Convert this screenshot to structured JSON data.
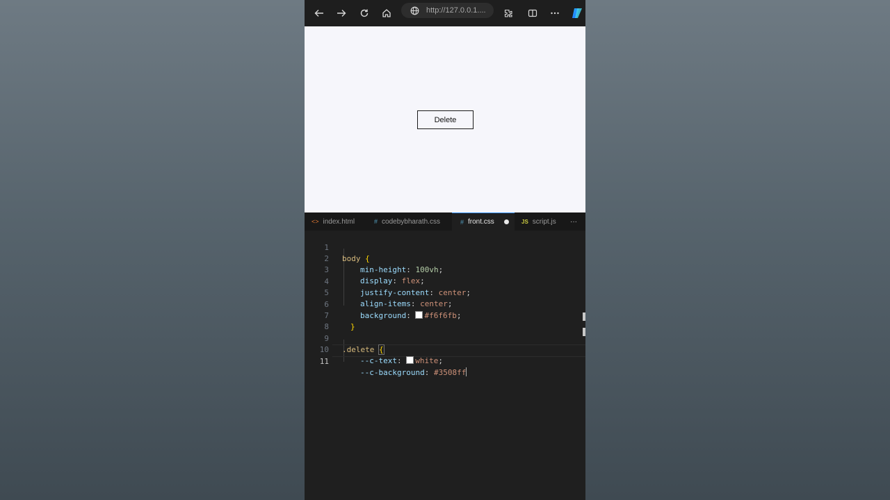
{
  "browser": {
    "url": "http://127.0.0.1....",
    "icons": [
      "back-icon",
      "forward-icon",
      "refresh-icon",
      "home-icon",
      "globe-icon",
      "extensions-icon",
      "split-view-icon",
      "more-icon",
      "copilot-icon"
    ]
  },
  "page": {
    "background": "#f6f6fb",
    "delete_label": "Delete"
  },
  "editor": {
    "tabs": [
      {
        "icon": "<>",
        "label": "index.html",
        "color": "#e37933"
      },
      {
        "icon": "#",
        "label": "codebybharath.css",
        "color": "#519aba"
      },
      {
        "icon": "#",
        "label": "front.css",
        "color": "#519aba",
        "active": true,
        "modified": true
      },
      {
        "icon": "JS",
        "label": "script.js",
        "color": "#cbcb41"
      }
    ],
    "more": "···",
    "lines": [
      {
        "n": "1",
        "sel": "body",
        "brace": "{"
      },
      {
        "n": "2",
        "prop": "min-height",
        "val": "100vh"
      },
      {
        "n": "3",
        "prop": "display",
        "val": "flex"
      },
      {
        "n": "4",
        "prop": "justify-content",
        "val": "center"
      },
      {
        "n": "5",
        "prop": "align-items",
        "val": "center"
      },
      {
        "n": "6",
        "prop": "background",
        "val": "#f6f6fb"
      },
      {
        "n": "7",
        "brace": "}"
      },
      {
        "n": "8"
      },
      {
        "n": "9",
        "sel": ".delete",
        "brace": "{"
      },
      {
        "n": "10",
        "prop": "--c-text",
        "val": "white"
      },
      {
        "n": "11",
        "prop": "--c-background",
        "val": "#3508ff"
      }
    ]
  },
  "colors": {
    "accent": "#3794ff",
    "selector": "#d7ba7d",
    "property": "#9cdcfe",
    "value": "#ce9178"
  }
}
